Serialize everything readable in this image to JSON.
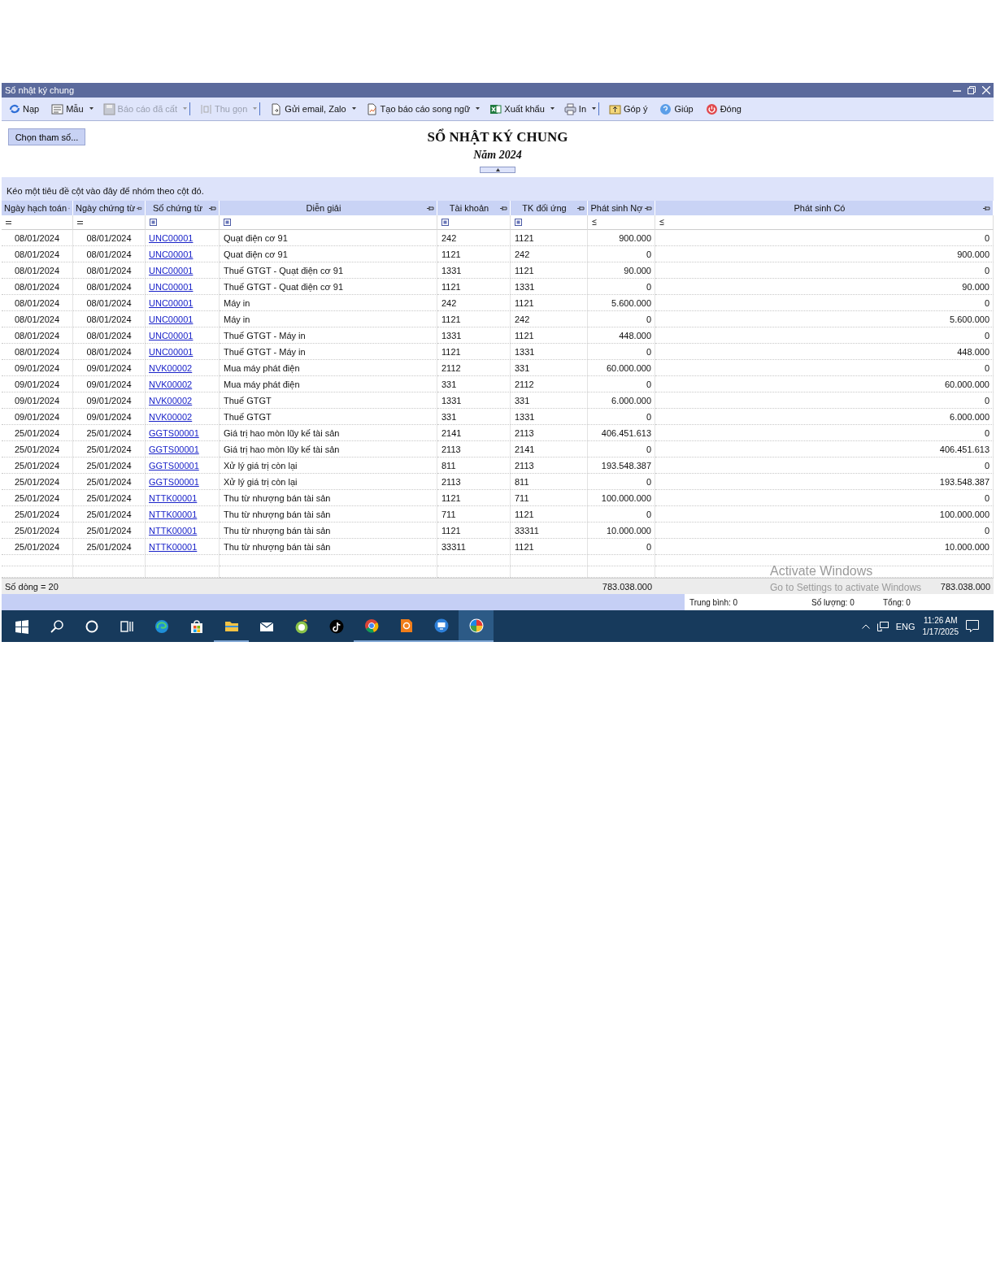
{
  "window": {
    "title": "Sổ nhật ký chung"
  },
  "toolbar": [
    {
      "kind": "refresh",
      "label": "Nạp",
      "disabled": false,
      "dropdown": false,
      "separator": false
    },
    {
      "kind": "form",
      "label": "Mẫu",
      "disabled": false,
      "dropdown": true,
      "separator": false
    },
    {
      "kind": "save",
      "label": "Báo cáo đã cất",
      "disabled": true,
      "dropdown": true,
      "separator": true
    },
    {
      "kind": "collapse",
      "label": "Thu gọn",
      "disabled": true,
      "dropdown": true,
      "separator": true
    },
    {
      "kind": "document",
      "label": "Gửi email, Zalo",
      "disabled": false,
      "dropdown": true,
      "separator": false
    },
    {
      "kind": "chart-document",
      "label": "Tạo báo cáo song ngữ",
      "disabled": false,
      "dropdown": true,
      "separator": false
    },
    {
      "kind": "spreadsheet",
      "label": "Xuất khẩu",
      "disabled": false,
      "dropdown": true,
      "separator": false
    },
    {
      "kind": "printer",
      "label": "In",
      "disabled": false,
      "dropdown": true,
      "separator": true
    },
    {
      "kind": "feedback",
      "label": "Góp ý",
      "disabled": false,
      "dropdown": false,
      "separator": false
    },
    {
      "kind": "help",
      "label": "Giúp",
      "disabled": false,
      "dropdown": false,
      "separator": false
    },
    {
      "kind": "power",
      "label": "Đóng",
      "disabled": false,
      "dropdown": false,
      "separator": false
    }
  ],
  "parameters_button": "Chọn tham số...",
  "report": {
    "title": "SỔ NHẬT KÝ CHUNG",
    "subtitle": "Năm 2024"
  },
  "group_panel": {
    "hint": "Kéo một tiêu đề cột vào đây để nhóm theo cột đó."
  },
  "table": {
    "columns": [
      {
        "label": "Ngày hạch toán",
        "kind": "date",
        "filter": {
          "kind": "equals"
        }
      },
      {
        "label": "Ngày chứng từ",
        "kind": "date",
        "filter": {
          "kind": "equals"
        }
      },
      {
        "label": "Số chứng từ",
        "kind": "link",
        "filter": {
          "kind": "contains"
        }
      },
      {
        "label": "Diễn giải",
        "kind": "text",
        "filter": {
          "kind": "contains"
        }
      },
      {
        "label": "Tài khoản",
        "kind": "text",
        "filter": {
          "kind": "contains"
        }
      },
      {
        "label": "TK đối ứng",
        "kind": "text",
        "filter": {
          "kind": "contains"
        }
      },
      {
        "label": "Phát sinh Nợ",
        "kind": "number",
        "filter": {
          "kind": "lte"
        }
      },
      {
        "label": "Phát sinh Có",
        "kind": "number",
        "filter": {
          "kind": "lte"
        }
      }
    ],
    "rows": [
      [
        "08/01/2024",
        "08/01/2024",
        "UNC00001",
        "Quạt điện cơ 91",
        "242",
        "1121",
        "900.000",
        "0"
      ],
      [
        "08/01/2024",
        "08/01/2024",
        "UNC00001",
        "Quat điện cơ 91",
        "1121",
        "242",
        "0",
        "900.000"
      ],
      [
        "08/01/2024",
        "08/01/2024",
        "UNC00001",
        "Thuế GTGT - Quạt điện cơ 91",
        "1331",
        "1121",
        "90.000",
        "0"
      ],
      [
        "08/01/2024",
        "08/01/2024",
        "UNC00001",
        "Thuế GTGT - Quat điện cơ 91",
        "1121",
        "1331",
        "0",
        "90.000"
      ],
      [
        "08/01/2024",
        "08/01/2024",
        "UNC00001",
        "Máy in",
        "242",
        "1121",
        "5.600.000",
        "0"
      ],
      [
        "08/01/2024",
        "08/01/2024",
        "UNC00001",
        "Máy in",
        "1121",
        "242",
        "0",
        "5.600.000"
      ],
      [
        "08/01/2024",
        "08/01/2024",
        "UNC00001",
        "Thuế GTGT - Máy in",
        "1331",
        "1121",
        "448.000",
        "0"
      ],
      [
        "08/01/2024",
        "08/01/2024",
        "UNC00001",
        "Thuế GTGT - Máy in",
        "1121",
        "1331",
        "0",
        "448.000"
      ],
      [
        "09/01/2024",
        "09/01/2024",
        "NVK00002",
        "Mua máy phát điện",
        "2112",
        "331",
        "60.000.000",
        "0"
      ],
      [
        "09/01/2024",
        "09/01/2024",
        "NVK00002",
        "Mua máy phát điện",
        "331",
        "2112",
        "0",
        "60.000.000"
      ],
      [
        "09/01/2024",
        "09/01/2024",
        "NVK00002",
        "Thuế GTGT",
        "1331",
        "331",
        "6.000.000",
        "0"
      ],
      [
        "09/01/2024",
        "09/01/2024",
        "NVK00002",
        "Thuế GTGT",
        "331",
        "1331",
        "0",
        "6.000.000"
      ],
      [
        "25/01/2024",
        "25/01/2024",
        "GGTS00001",
        "Giá trị hao mòn lũy kế tài sản",
        "2141",
        "2113",
        "406.451.613",
        "0"
      ],
      [
        "25/01/2024",
        "25/01/2024",
        "GGTS00001",
        "Giá trị hao mòn lũy kế tài sản",
        "2113",
        "2141",
        "0",
        "406.451.613"
      ],
      [
        "25/01/2024",
        "25/01/2024",
        "GGTS00001",
        "Xử lý giá trị còn lại",
        "811",
        "2113",
        "193.548.387",
        "0"
      ],
      [
        "25/01/2024",
        "25/01/2024",
        "GGTS00001",
        "Xử lý giá trị còn lại",
        "2113",
        "811",
        "0",
        "193.548.387"
      ],
      [
        "25/01/2024",
        "25/01/2024",
        "NTTK00001",
        "Thu từ nhượng bán tài sản",
        "1121",
        "711",
        "100.000.000",
        "0"
      ],
      [
        "25/01/2024",
        "25/01/2024",
        "NTTK00001",
        "Thu từ nhượng bán tài sản",
        "711",
        "1121",
        "0",
        "100.000.000"
      ],
      [
        "25/01/2024",
        "25/01/2024",
        "NTTK00001",
        "Thu từ nhượng bán tài sản",
        "1121",
        "33311",
        "10.000.000",
        "0"
      ],
      [
        "25/01/2024",
        "25/01/2024",
        "NTTK00001",
        "Thu từ nhượng bán tài sản",
        "33311",
        "1121",
        "0",
        "10.000.000"
      ]
    ],
    "footer": {
      "row_count": "Số dòng = 20",
      "debit_total": "783.038.000",
      "credit_total": "783.038.000"
    }
  },
  "status_bar": {
    "average": "Trung bình: 0",
    "count": "Số lượng: 0",
    "sum": "Tổng: 0"
  },
  "activation_notice": {
    "title": "Activate Windows",
    "message": "Go to Settings to activate Windows"
  },
  "taskbar": {
    "apps": [
      {
        "kind": "start",
        "running": false,
        "selected": false
      },
      {
        "kind": "search",
        "running": false,
        "selected": false
      },
      {
        "kind": "cortana",
        "running": false,
        "selected": false
      },
      {
        "kind": "task-view",
        "running": false,
        "selected": false
      },
      {
        "kind": "edge",
        "running": false,
        "selected": false
      },
      {
        "kind": "store",
        "running": false,
        "selected": false
      },
      {
        "kind": "explorer",
        "running": true,
        "selected": false
      },
      {
        "kind": "mail",
        "running": false,
        "selected": false
      },
      {
        "kind": "leaf",
        "running": false,
        "selected": false
      },
      {
        "kind": "note",
        "running": false,
        "selected": false
      },
      {
        "kind": "chrome",
        "running": true,
        "selected": false
      },
      {
        "kind": "pdf",
        "running": true,
        "selected": false
      },
      {
        "kind": "remote",
        "running": true,
        "selected": false
      },
      {
        "kind": "quad",
        "running": true,
        "selected": true
      }
    ],
    "tray": {
      "language": "ENG",
      "time": "11:26 AM",
      "date": "1/17/2025"
    }
  }
}
